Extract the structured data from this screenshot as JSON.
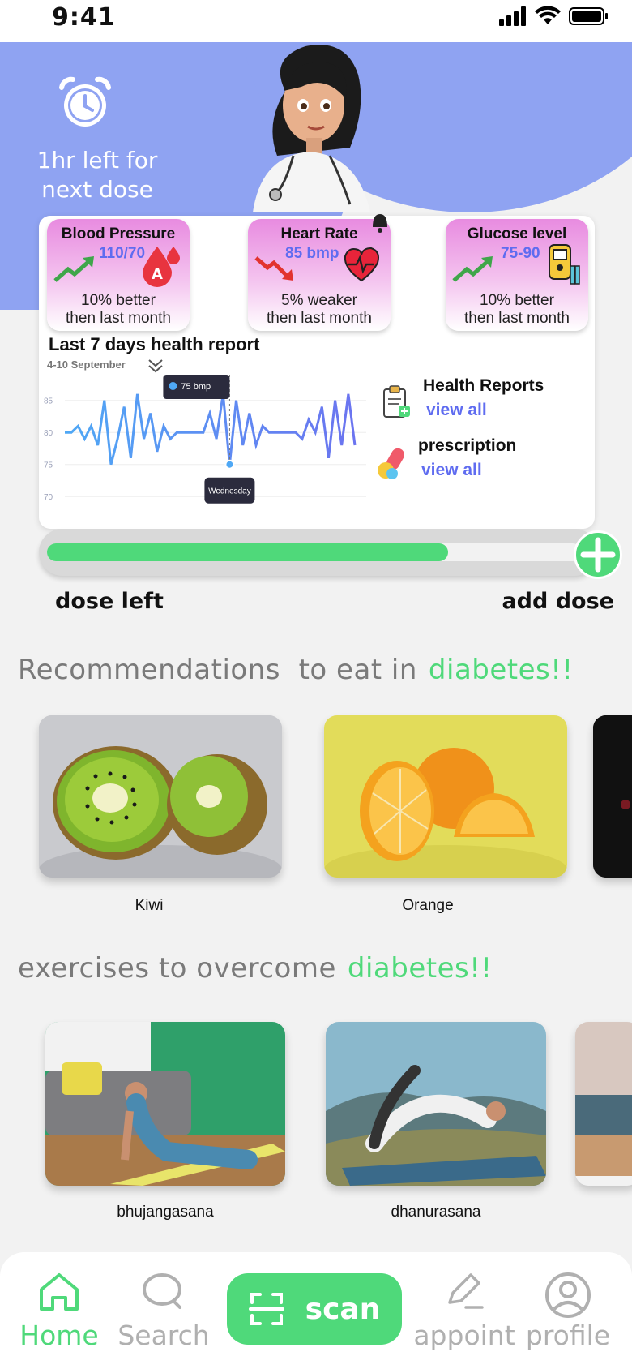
{
  "status_bar": {
    "time": "9:41"
  },
  "hero": {
    "dose_line1": "1hr left for",
    "dose_line2": "next dose"
  },
  "metrics": [
    {
      "title": "Blood Pressure",
      "value": "110/70",
      "line1": "10% better",
      "line2": "then last month",
      "trend": "up",
      "icon": "blood-drop-icon"
    },
    {
      "title": "Heart Rate",
      "value": "85 bmp",
      "line1": "5% weaker",
      "line2": "then last month",
      "trend": "down",
      "icon": "heart-icon"
    },
    {
      "title": "Glucose level",
      "value": "75-90",
      "line1": "10% better",
      "line2": "then last month",
      "trend": "up",
      "icon": "glucometer-icon"
    }
  ],
  "report": {
    "title": "Last 7 days health report",
    "subtitle": "4-10 September",
    "tooltip_value": "75 bmp",
    "tooltip_day": "Wednesday"
  },
  "chart_data": {
    "type": "line",
    "title": "",
    "y_ticks": [
      "85",
      "80",
      "75",
      "70"
    ],
    "ylim": [
      68,
      88
    ],
    "series": [
      {
        "name": "",
        "values": [
          80,
          80,
          81,
          79,
          81,
          78,
          85,
          75,
          79,
          84,
          76,
          86,
          79,
          83,
          77,
          81,
          79,
          80,
          80,
          80,
          80,
          80,
          83,
          79,
          86,
          75,
          85,
          78,
          83,
          78,
          81,
          80,
          80,
          80,
          80,
          80,
          79,
          82,
          80,
          84,
          76,
          85,
          78,
          86,
          78
        ]
      }
    ],
    "highlight": {
      "index": 25,
      "value": 75
    },
    "grid": true,
    "colors": [
      "#4fa8f5",
      "#6b74f0"
    ]
  },
  "side_links": [
    {
      "title": "Health Reports",
      "link": "view all"
    },
    {
      "title": "prescription",
      "link": "view all"
    }
  ],
  "dose": {
    "progress": 0.75,
    "left_label": "dose left",
    "add_label": "add dose"
  },
  "recommendations": {
    "title": "Recommendations  to eat in",
    "accent": "diabetes!!",
    "items": [
      {
        "label": "Kiwi"
      },
      {
        "label": "Orange"
      }
    ]
  },
  "exercises": {
    "title": "exercises to overcome",
    "accent": "diabetes!!",
    "items": [
      {
        "label": "bhujangasana"
      },
      {
        "label": "dhanurasana"
      }
    ]
  },
  "nav": {
    "home": "Home",
    "search": "Search",
    "scan": "scan",
    "appoint": "appoint",
    "profile": "profile",
    "accent": "#4fd97a"
  }
}
